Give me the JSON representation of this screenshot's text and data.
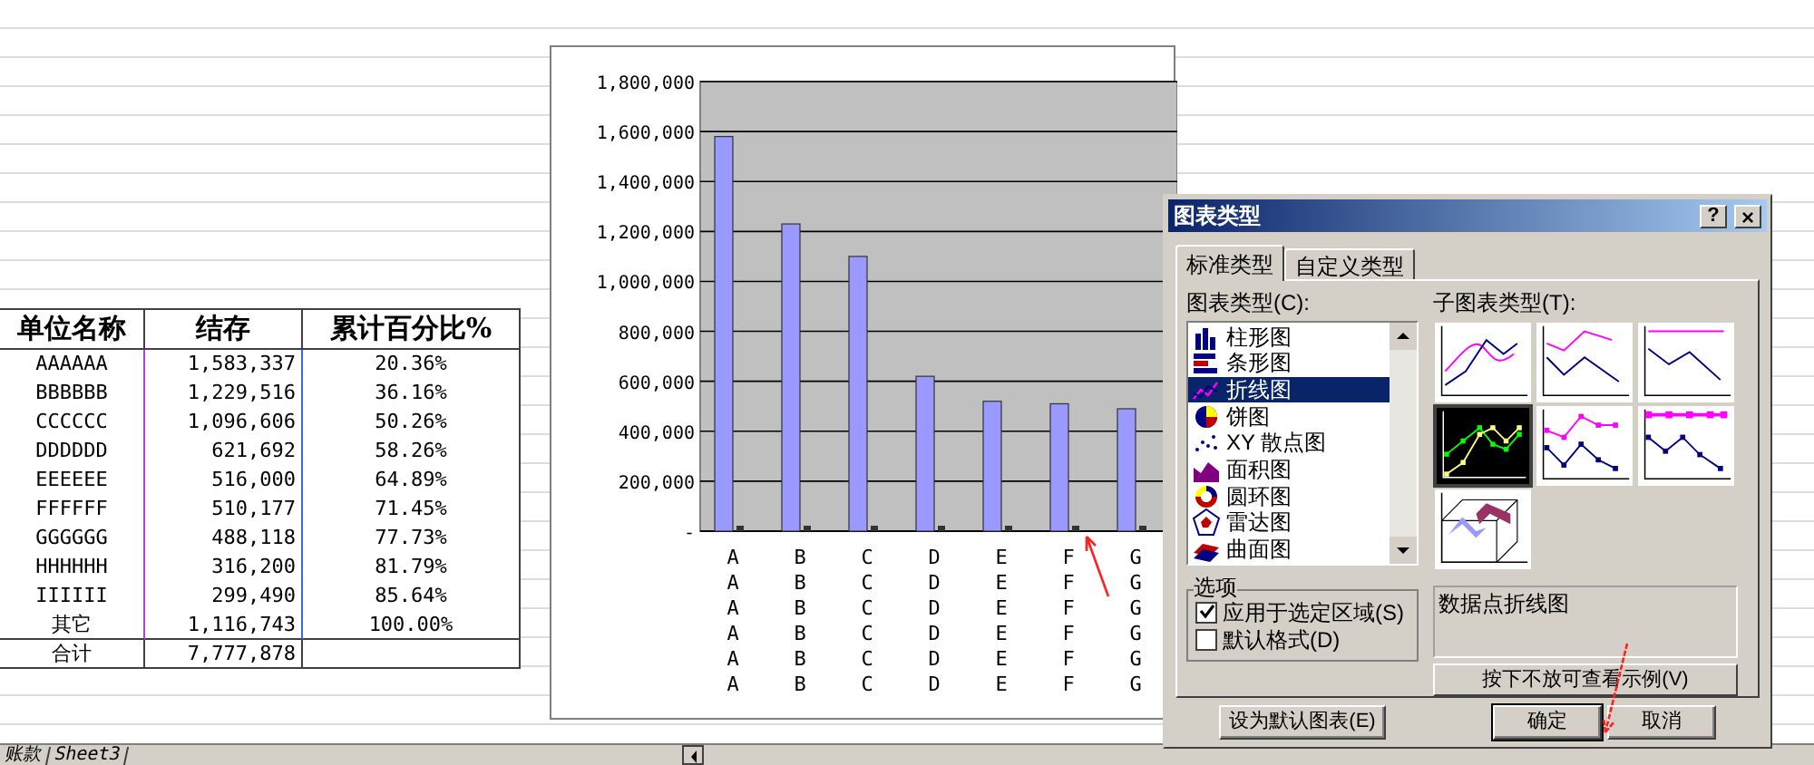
{
  "sheet": {
    "columns": [
      "单位名称",
      "结存",
      "累计百分比%"
    ],
    "rows": [
      [
        "AAAAAA",
        "1,583,337",
        "20.36%"
      ],
      [
        "BBBBBB",
        "1,229,516",
        "36.16%"
      ],
      [
        "CCCCCC",
        "1,096,606",
        "50.26%"
      ],
      [
        "DDDDDD",
        "621,692",
        "58.26%"
      ],
      [
        "EEEEEE",
        "516,000",
        "64.89%"
      ],
      [
        "FFFFFF",
        "510,177",
        "71.45%"
      ],
      [
        "GGGGGG",
        "488,118",
        "77.73%"
      ],
      [
        "HHHHHH",
        "316,200",
        "81.79%"
      ],
      [
        "IIIIII",
        "299,490",
        "85.64%"
      ],
      [
        "其它",
        "1,116,743",
        "100.00%"
      ],
      [
        "合计",
        "7,777,878"
      ]
    ]
  },
  "chart": {
    "chart_data": {
      "type": "bar",
      "categories": [
        "AAAAAA",
        "BBBBBB",
        "CCCCCC",
        "DDDDDD",
        "EEEEEE",
        "FFFFFF",
        "GGGGGG"
      ],
      "series": [
        {
          "color": "#9999ff",
          "values": [
            1580000,
            1230000,
            1100000,
            620000,
            520000,
            510000,
            490000
          ]
        },
        {
          "color": "#333333",
          "values": [
            0,
            0,
            0,
            0,
            0,
            0,
            0
          ]
        }
      ],
      "grid": true,
      "ylim": [
        0,
        1800000
      ],
      "yticks": [
        {
          "value": 0,
          "label": "-"
        },
        {
          "value": 200000,
          "label": "200,000"
        },
        {
          "value": 400000,
          "label": "400,000"
        },
        {
          "value": 600000,
          "label": "600,000"
        },
        {
          "value": 800000,
          "label": "800,000"
        },
        {
          "value": 1000000,
          "label": "1,000,000"
        },
        {
          "value": 1200000,
          "label": "1,200,000"
        },
        {
          "value": 1400000,
          "label": "1,400,000"
        },
        {
          "value": 1600000,
          "label": "1,600,000"
        },
        {
          "value": 1800000,
          "label": "1,800,000"
        }
      ]
    }
  },
  "dialog": {
    "title": "图表类型",
    "help": "?",
    "close": "×",
    "tabs": [
      {
        "label": "标准类型",
        "selected": true
      },
      {
        "label": "自定义类型",
        "selected": false
      }
    ],
    "chart_types_label": "图表类型(C):",
    "chart_types": [
      {
        "label": "柱形图",
        "selected": false
      },
      {
        "label": "条形图",
        "selected": false
      },
      {
        "label": "折线图",
        "selected": true
      },
      {
        "label": "饼图",
        "selected": false
      },
      {
        "label": "XY 散点图",
        "selected": false
      },
      {
        "label": "面积图",
        "selected": false
      },
      {
        "label": "圆环图",
        "selected": false
      },
      {
        "label": "雷达图",
        "selected": false
      },
      {
        "label": "曲面图",
        "selected": false
      }
    ],
    "subtypes_label": "子图表类型(T):",
    "subtypes": [
      {
        "kind": "line",
        "selected": false
      },
      {
        "kind": "stacked",
        "selected": false
      },
      {
        "kind": "percent",
        "selected": false
      },
      {
        "kind": "markers",
        "selected": true
      },
      {
        "kind": "stacked-markers",
        "selected": false
      },
      {
        "kind": "percent-markers",
        "selected": false
      },
      {
        "kind": "ribbon",
        "selected": false
      }
    ],
    "options_label": "选项",
    "options": [
      {
        "label": "应用于选定区域(S)",
        "checked": true
      },
      {
        "label": "默认格式(D)",
        "checked": false
      }
    ],
    "description": "数据点折线图",
    "preview_button": "按下不放可查看示例(V)",
    "default_button": "设为默认图表(E)",
    "ok_button": "确定",
    "cancel_button": "取消"
  },
  "sheet_tabs": [
    {
      "label": "账款"
    },
    {
      "label": "Sheet3"
    }
  ]
}
